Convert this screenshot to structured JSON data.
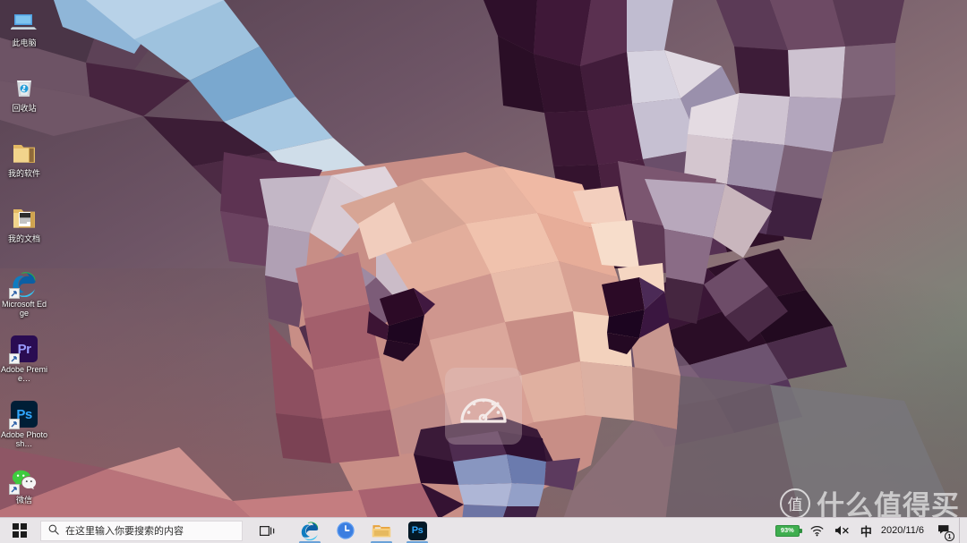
{
  "desktop": {
    "icons": [
      {
        "label": "此电脑",
        "icon": "this-pc-icon",
        "shortcut": false
      },
      {
        "label": "回收站",
        "icon": "recycle-bin-icon",
        "shortcut": false
      },
      {
        "label": "我的软件",
        "icon": "folder-icon",
        "shortcut": false
      },
      {
        "label": "我的文档",
        "icon": "folder-documents-icon",
        "shortcut": false
      },
      {
        "label": "Microsoft Edge",
        "icon": "microsoft-edge-icon",
        "shortcut": true,
        "tile": "",
        "tile_bg": ""
      },
      {
        "label": "Adobe Premie…",
        "icon": "adobe-premiere-icon",
        "shortcut": true,
        "tile": "Pr",
        "tile_bg": "#2a0c52",
        "tile_fg": "#9a9cff"
      },
      {
        "label": "Adobe Photosh…",
        "icon": "adobe-photoshop-icon",
        "shortcut": true,
        "tile": "Ps",
        "tile_bg": "#001e36",
        "tile_fg": "#31a8ff"
      },
      {
        "label": "微信",
        "icon": "wechat-icon",
        "shortcut": true
      }
    ],
    "gauge_overlay": {
      "icon": "speedometer-icon"
    },
    "watermark": {
      "badge": "值",
      "text": "什么值得买"
    }
  },
  "taskbar": {
    "start": {
      "label": "开始",
      "icon": "windows-logo-icon"
    },
    "search": {
      "placeholder": "在这里输入你要搜索的内容",
      "icon": "search-icon"
    },
    "task_view": {
      "label": "任务视图",
      "icon": "task-view-icon"
    },
    "pinned": [
      {
        "name": "microsoft-edge",
        "label": "Microsoft Edge",
        "running": true
      },
      {
        "name": "clock-app",
        "label": "时钟",
        "running": false
      },
      {
        "name": "file-explorer",
        "label": "文件资源管理器",
        "running": true
      },
      {
        "name": "photoshop",
        "label": "Adobe Photoshop",
        "running": true,
        "tile": "Ps",
        "tile_bg": "#031927",
        "tile_fg": "#31a8ff"
      }
    ],
    "tray": {
      "battery": {
        "percent": "93%",
        "icon": "battery-icon"
      },
      "network": {
        "label": "网络",
        "icon": "wifi-icon"
      },
      "volume": {
        "label": "音量已静音",
        "icon": "speaker-mute-icon"
      },
      "ime": {
        "label": "中",
        "icon": "ime-chinese-icon"
      },
      "clock": {
        "date": "2020/11/6"
      },
      "notifications": {
        "count": "1",
        "icon": "action-center-icon"
      },
      "show_desktop": {
        "label": "显示桌面"
      }
    }
  },
  "colors": {
    "taskbar_bg": "#e8e5e8",
    "search_bg": "#fbfafb",
    "accent_underline": "#6aa2d8",
    "battery_green": "#3fae4f",
    "wallpaper_plum": "#6b5360",
    "wallpaper_sage": "#7c8478",
    "deer_peach": "#e9a893",
    "deer_cream": "#f6e3d6",
    "deer_maroon": "#3a1030"
  }
}
